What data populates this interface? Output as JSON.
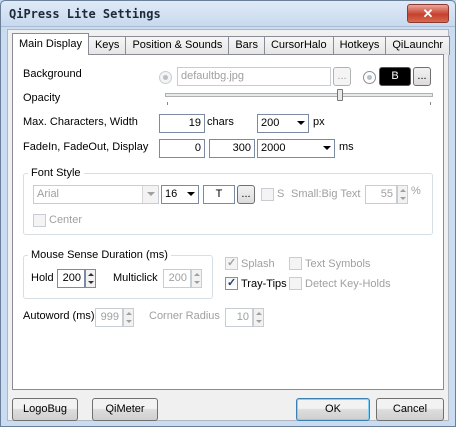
{
  "window": {
    "title": "QiPress Lite Settings",
    "close_symbol": "✕"
  },
  "tabs": [
    {
      "label": "Main Display",
      "active": true
    },
    {
      "label": "Keys"
    },
    {
      "label": "Position & Sounds"
    },
    {
      "label": "Bars"
    },
    {
      "label": "CursorHalo"
    },
    {
      "label": "Hotkeys"
    },
    {
      "label": "QiLaunchr"
    }
  ],
  "background": {
    "label": "Background",
    "image_value": "defaultbg.jpg",
    "browse_label": "...",
    "color_button_label": "B",
    "color_browse_label": "..."
  },
  "opacity": {
    "label": "Opacity",
    "level_fraction": 0.66
  },
  "max_chars": {
    "label": "Max. Characters, Width",
    "chars_value": "19",
    "chars_unit": "chars",
    "width_value": "200",
    "width_unit": "px"
  },
  "fade": {
    "label": "FadeIn, FadeOut, Display",
    "fadein_value": "0",
    "fadeout_value": "300",
    "display_value": "2000",
    "unit": "ms"
  },
  "font_style": {
    "group_label": "Font Style",
    "font_value": "Arial",
    "size_value": "16",
    "t_button_label": "T",
    "browse_label": "...",
    "s_label": "S",
    "ratio_label": "Small:Big Text",
    "ratio_value": "55",
    "percent_label": "%",
    "center_label": "Center"
  },
  "mouse_sense": {
    "group_label": "Mouse Sense Duration (ms)",
    "hold_label": "Hold",
    "hold_value": "200",
    "multiclick_label": "Multiclick",
    "multiclick_value": "200"
  },
  "options": {
    "splash": "Splash",
    "tray_tips": "Tray-Tips",
    "text_symbols": "Text Symbols",
    "detect_key_holds": "Detect Key-Holds"
  },
  "autoword": {
    "label": "Autoword (ms)",
    "value": "999"
  },
  "corner_radius": {
    "label": "Corner Radius",
    "value": "10"
  },
  "buttons": {
    "logobug": "LogoBug",
    "qimeter": "QiMeter",
    "ok": "OK",
    "cancel": "Cancel"
  },
  "colors": {
    "color_swatch": "#000000",
    "titlebar": "#c8d9ee"
  }
}
